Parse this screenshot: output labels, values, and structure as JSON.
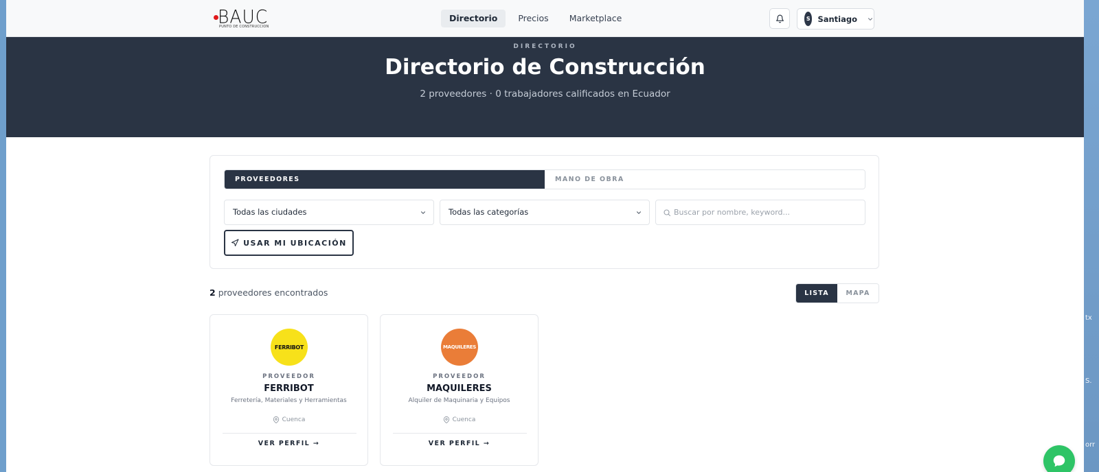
{
  "desktop": {
    "edge_labels": [
      "tx",
      "S.",
      "orr"
    ]
  },
  "brand": {
    "logo_text": "BAUC",
    "tagline": "PUNTO DE CONSTRUCCION",
    "accent": "#e0191b"
  },
  "nav": {
    "items": [
      {
        "label": "Directorio",
        "active": true
      },
      {
        "label": "Precios",
        "active": false
      },
      {
        "label": "Marketplace",
        "active": false
      }
    ]
  },
  "user": {
    "initial": "S",
    "name": "Santiago"
  },
  "hero": {
    "kicker": "DIRECTORIO",
    "title": "Directorio de Construcción",
    "subtitle": "2 proveedores · 0 trabajadores calificados en Ecuador",
    "background": "#2a3444"
  },
  "filters": {
    "tabs": [
      {
        "label": "PROVEEDORES",
        "active": true
      },
      {
        "label": "MANO DE OBRA",
        "active": false
      }
    ],
    "city_select": "Todas las ciudades",
    "category_select": "Todas las categorías",
    "search_placeholder": "Buscar por nombre, keyword...",
    "location_button": "USAR MI UBICACIÓN"
  },
  "results": {
    "count": "2",
    "label": "proveedores encontrados",
    "view_list": "LISTA",
    "view_map": "MAPA"
  },
  "cards": [
    {
      "logo_text": "FERRIBOT",
      "logo_color": "#f7e11a",
      "type": "PROVEEDOR",
      "name": "FERRIBOT",
      "category": "Ferretería, Materiales y Herramientas",
      "city": "Cuenca",
      "link": "VER PERFIL →"
    },
    {
      "logo_text": "MAQUILERES",
      "logo_color": "#ea7d38",
      "type": "PROVEEDOR",
      "name": "MAQUILERES",
      "category": "Alquiler de Maquinaria y Equipos",
      "city": "Cuenca",
      "link": "VER PERFIL →"
    }
  ],
  "chat": {
    "color": "#2ec466"
  }
}
